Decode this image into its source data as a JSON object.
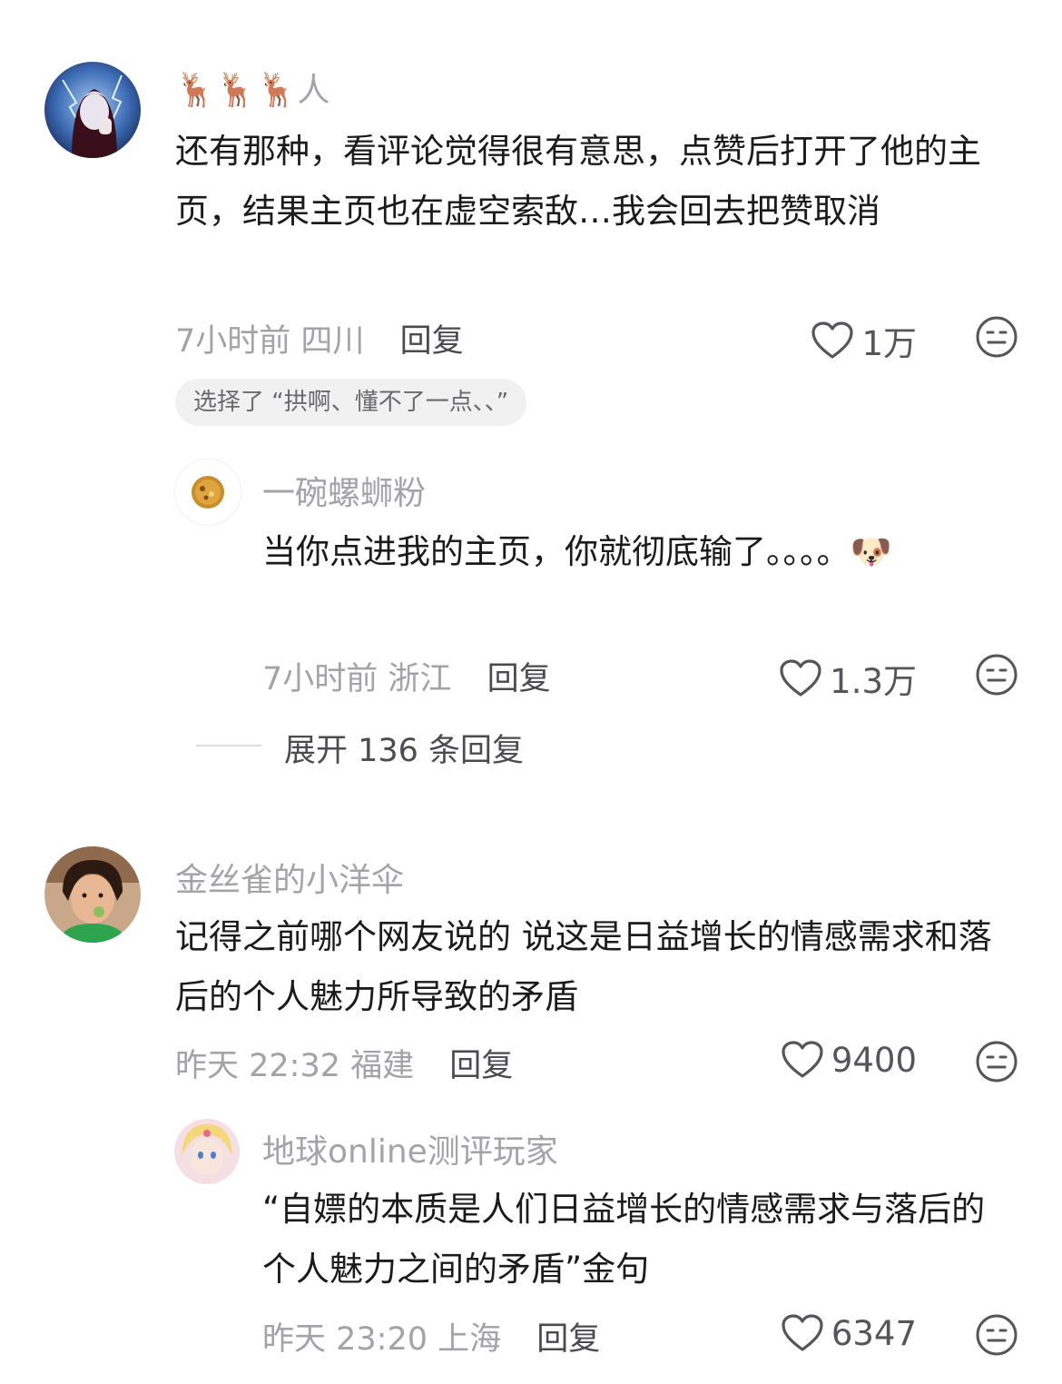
{
  "comments": [
    {
      "username": "🦌🦌🦌人",
      "text": "还有那种，看评论觉得很有意思，点赞后打开了他的主页，结果主页也在虚空索敌…我会回去把赞取消",
      "time": "7小时前",
      "location": "四川",
      "reply_label": "回复",
      "likes": "1万",
      "selected_tag": "选择了 “拱啊、懂不了一点、、”",
      "replies": [
        {
          "username": "一碗螺蛳粉",
          "text": "当你点进我的主页，你就彻底输了。。。。🐶",
          "emoji": "🐶",
          "time": "7小时前",
          "location": "浙江",
          "reply_label": "回复",
          "likes": "1.3万"
        }
      ],
      "expand_label": "展开 136 条回复"
    },
    {
      "username": "金丝雀的小洋伞",
      "text": "记得之前哪个网友说的   说这是日益增长的情感需求和落后的个人魅力所导致的矛盾",
      "time": "昨天 22:32",
      "location": "福建",
      "reply_label": "回复",
      "likes": "9400",
      "replies": [
        {
          "username": "地球online测评玩家",
          "text": "“自嫖的本质是人们日益增长的情感需求与落后的个人魅力之间的矛盾”金句",
          "time": "昨天 23:20",
          "location": "上海",
          "reply_label": "回复",
          "likes": "6347"
        }
      ]
    }
  ],
  "colors": {
    "username": "#a3a3a8",
    "text": "#1b1b1b",
    "meta": "#a2a2a7",
    "chip_bg": "#f1f1f2"
  },
  "icons": [
    "heart-outline-icon",
    "meh-face-icon"
  ]
}
